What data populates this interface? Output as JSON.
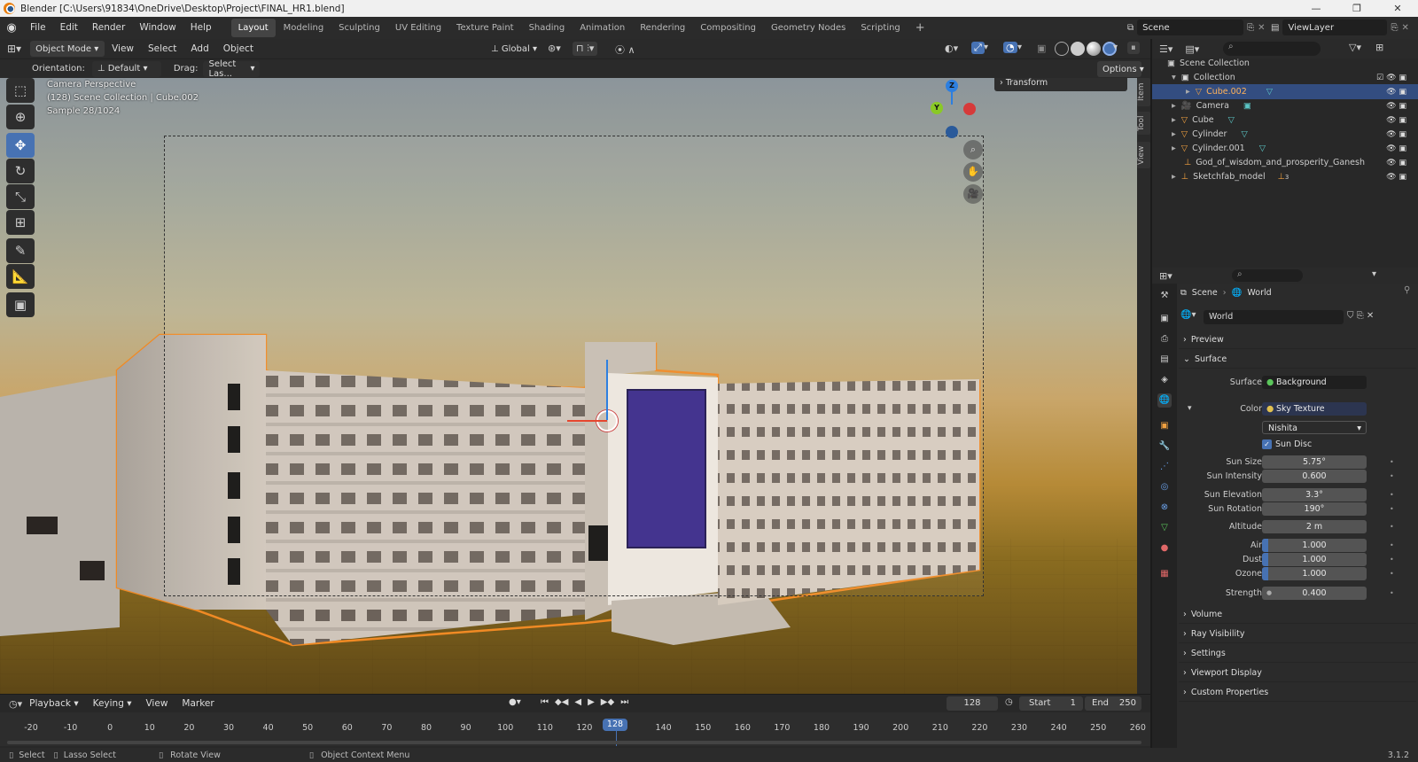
{
  "window": {
    "title": "Blender [C:\\Users\\91834\\OneDrive\\Desktop\\Project\\FINAL_HR1.blend]",
    "min": "—",
    "max": "❐",
    "close": "✕"
  },
  "menu": [
    "File",
    "Edit",
    "Render",
    "Window",
    "Help"
  ],
  "workspaces": [
    "Layout",
    "Modeling",
    "Sculpting",
    "UV Editing",
    "Texture Paint",
    "Shading",
    "Animation",
    "Rendering",
    "Compositing",
    "Geometry Nodes",
    "Scripting"
  ],
  "workspace_add": "+",
  "scene_name": "Scene",
  "view_layer": "ViewLayer",
  "viewport_header": {
    "mode": "Object Mode",
    "menus": [
      "View",
      "Select",
      "Add",
      "Object"
    ],
    "transform": "Global"
  },
  "toolsettings": {
    "orientation_label": "Orientation:",
    "orientation_value": "Default",
    "drag_label": "Drag:",
    "drag_value": "Select Las...",
    "options": "Options"
  },
  "overlay_text": {
    "line1": "Camera Perspective",
    "line2": "(128) Scene Collection | Cube.002",
    "line3": "Sample 28/1024"
  },
  "transform_panel": "Transform",
  "side_tabs": [
    "Item",
    "Tool",
    "View"
  ],
  "gizmo": {
    "x": "",
    "y": "Y",
    "z": "Z"
  },
  "outliner": {
    "root": "Scene Collection",
    "items": [
      {
        "name": "Collection",
        "indent": 1
      },
      {
        "name": "Cube.002",
        "indent": 2,
        "selected": true
      },
      {
        "name": "Camera",
        "indent": 1
      },
      {
        "name": "Cube",
        "indent": 1
      },
      {
        "name": "Cylinder",
        "indent": 1
      },
      {
        "name": "Cylinder.001",
        "indent": 1
      },
      {
        "name": "God_of_wisdom_and_prosperity_Ganesh",
        "indent": 1
      },
      {
        "name": "Sketchfab_model",
        "indent": 1
      }
    ],
    "sketchfab_badge": "3"
  },
  "properties": {
    "breadcrumb_scene": "Scene",
    "breadcrumb_world": "World",
    "world_name": "World",
    "panels_top": [
      "Preview",
      "Surface"
    ],
    "surface_label": "Surface",
    "surface_value": "Background",
    "color_label": "Color",
    "color_value": "Sky Texture",
    "sky_type": "Nishita",
    "sun_disc": "Sun Disc",
    "fields": [
      {
        "label": "Sun Size",
        "value": "5.75°",
        "fill": 0
      },
      {
        "label": "Sun Intensity",
        "value": "0.600",
        "fill": 0
      },
      {
        "label": "Sun Elevation",
        "value": "3.3°",
        "fill": 0
      },
      {
        "label": "Sun Rotation",
        "value": "190°",
        "fill": 0
      },
      {
        "label": "Altitude",
        "value": "2 m",
        "fill": 0
      },
      {
        "label": "Air",
        "value": "1.000",
        "fill": 0.1
      },
      {
        "label": "Dust",
        "value": "1.000",
        "fill": 0.1
      },
      {
        "label": "Ozone",
        "value": "1.000",
        "fill": 0.1
      }
    ],
    "strength_label": "Strength",
    "strength_value": "0.400",
    "panels_bottom": [
      "Volume",
      "Ray Visibility",
      "Settings",
      "Viewport Display",
      "Custom Properties"
    ]
  },
  "timeline": {
    "menus": [
      "Playback",
      "Keying",
      "View",
      "Marker"
    ],
    "current_frame": "128",
    "start_label": "Start",
    "start": "1",
    "end_label": "End",
    "end": "250",
    "ticks": [
      "-20",
      "-10",
      "0",
      "10",
      "20",
      "30",
      "40",
      "50",
      "60",
      "70",
      "80",
      "90",
      "100",
      "110",
      "120",
      "128",
      "140",
      "150",
      "160",
      "170",
      "180",
      "190",
      "200",
      "210",
      "220",
      "230",
      "240",
      "250",
      "260"
    ]
  },
  "statusbar": {
    "select": "Select",
    "lasso": "Lasso Select",
    "rotate": "Rotate View",
    "context": "Object Context Menu",
    "version": "3.1.2"
  }
}
